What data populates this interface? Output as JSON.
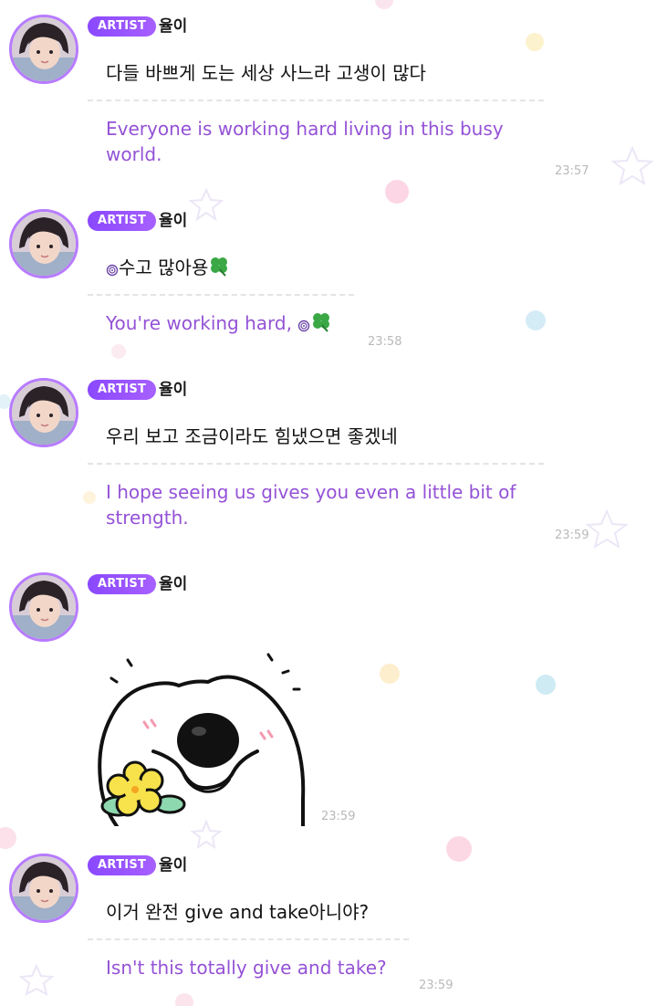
{
  "messages": [
    {
      "badge": "ARTIST",
      "author": "율이",
      "text": "다들 바쁘게 도는 세상 사느라 고생이 많다",
      "translation": "Everyone is working hard living in this busy world.",
      "time": "23:57"
    },
    {
      "badge": "ARTIST",
      "author": "율이",
      "text": "수고 많아용",
      "translation": "You're working hard,",
      "time": "23:58",
      "emojis": [
        "spiral-emoji",
        "four-leaf-clover-emoji"
      ]
    },
    {
      "badge": "ARTIST",
      "author": "율이",
      "text": "우리 보고 조금이라도 힘냈으면 좋겠네",
      "translation": "I hope seeing us gives you even a little bit of strength.",
      "time": "23:59"
    },
    {
      "badge": "ARTIST",
      "author": "율이",
      "sticker": "puppy-with-flower-sticker",
      "time": "23:59"
    },
    {
      "badge": "ARTIST",
      "author": "율이",
      "text": "이거 완전 give and take아니야?",
      "translation": "Isn't this totally give and take?",
      "time": "23:59"
    }
  ],
  "colors": {
    "badge": "#9b55ff",
    "avatar_ring": "#b77bff",
    "translation_text": "#9452d6",
    "timestamp": "#b9b9b9"
  }
}
